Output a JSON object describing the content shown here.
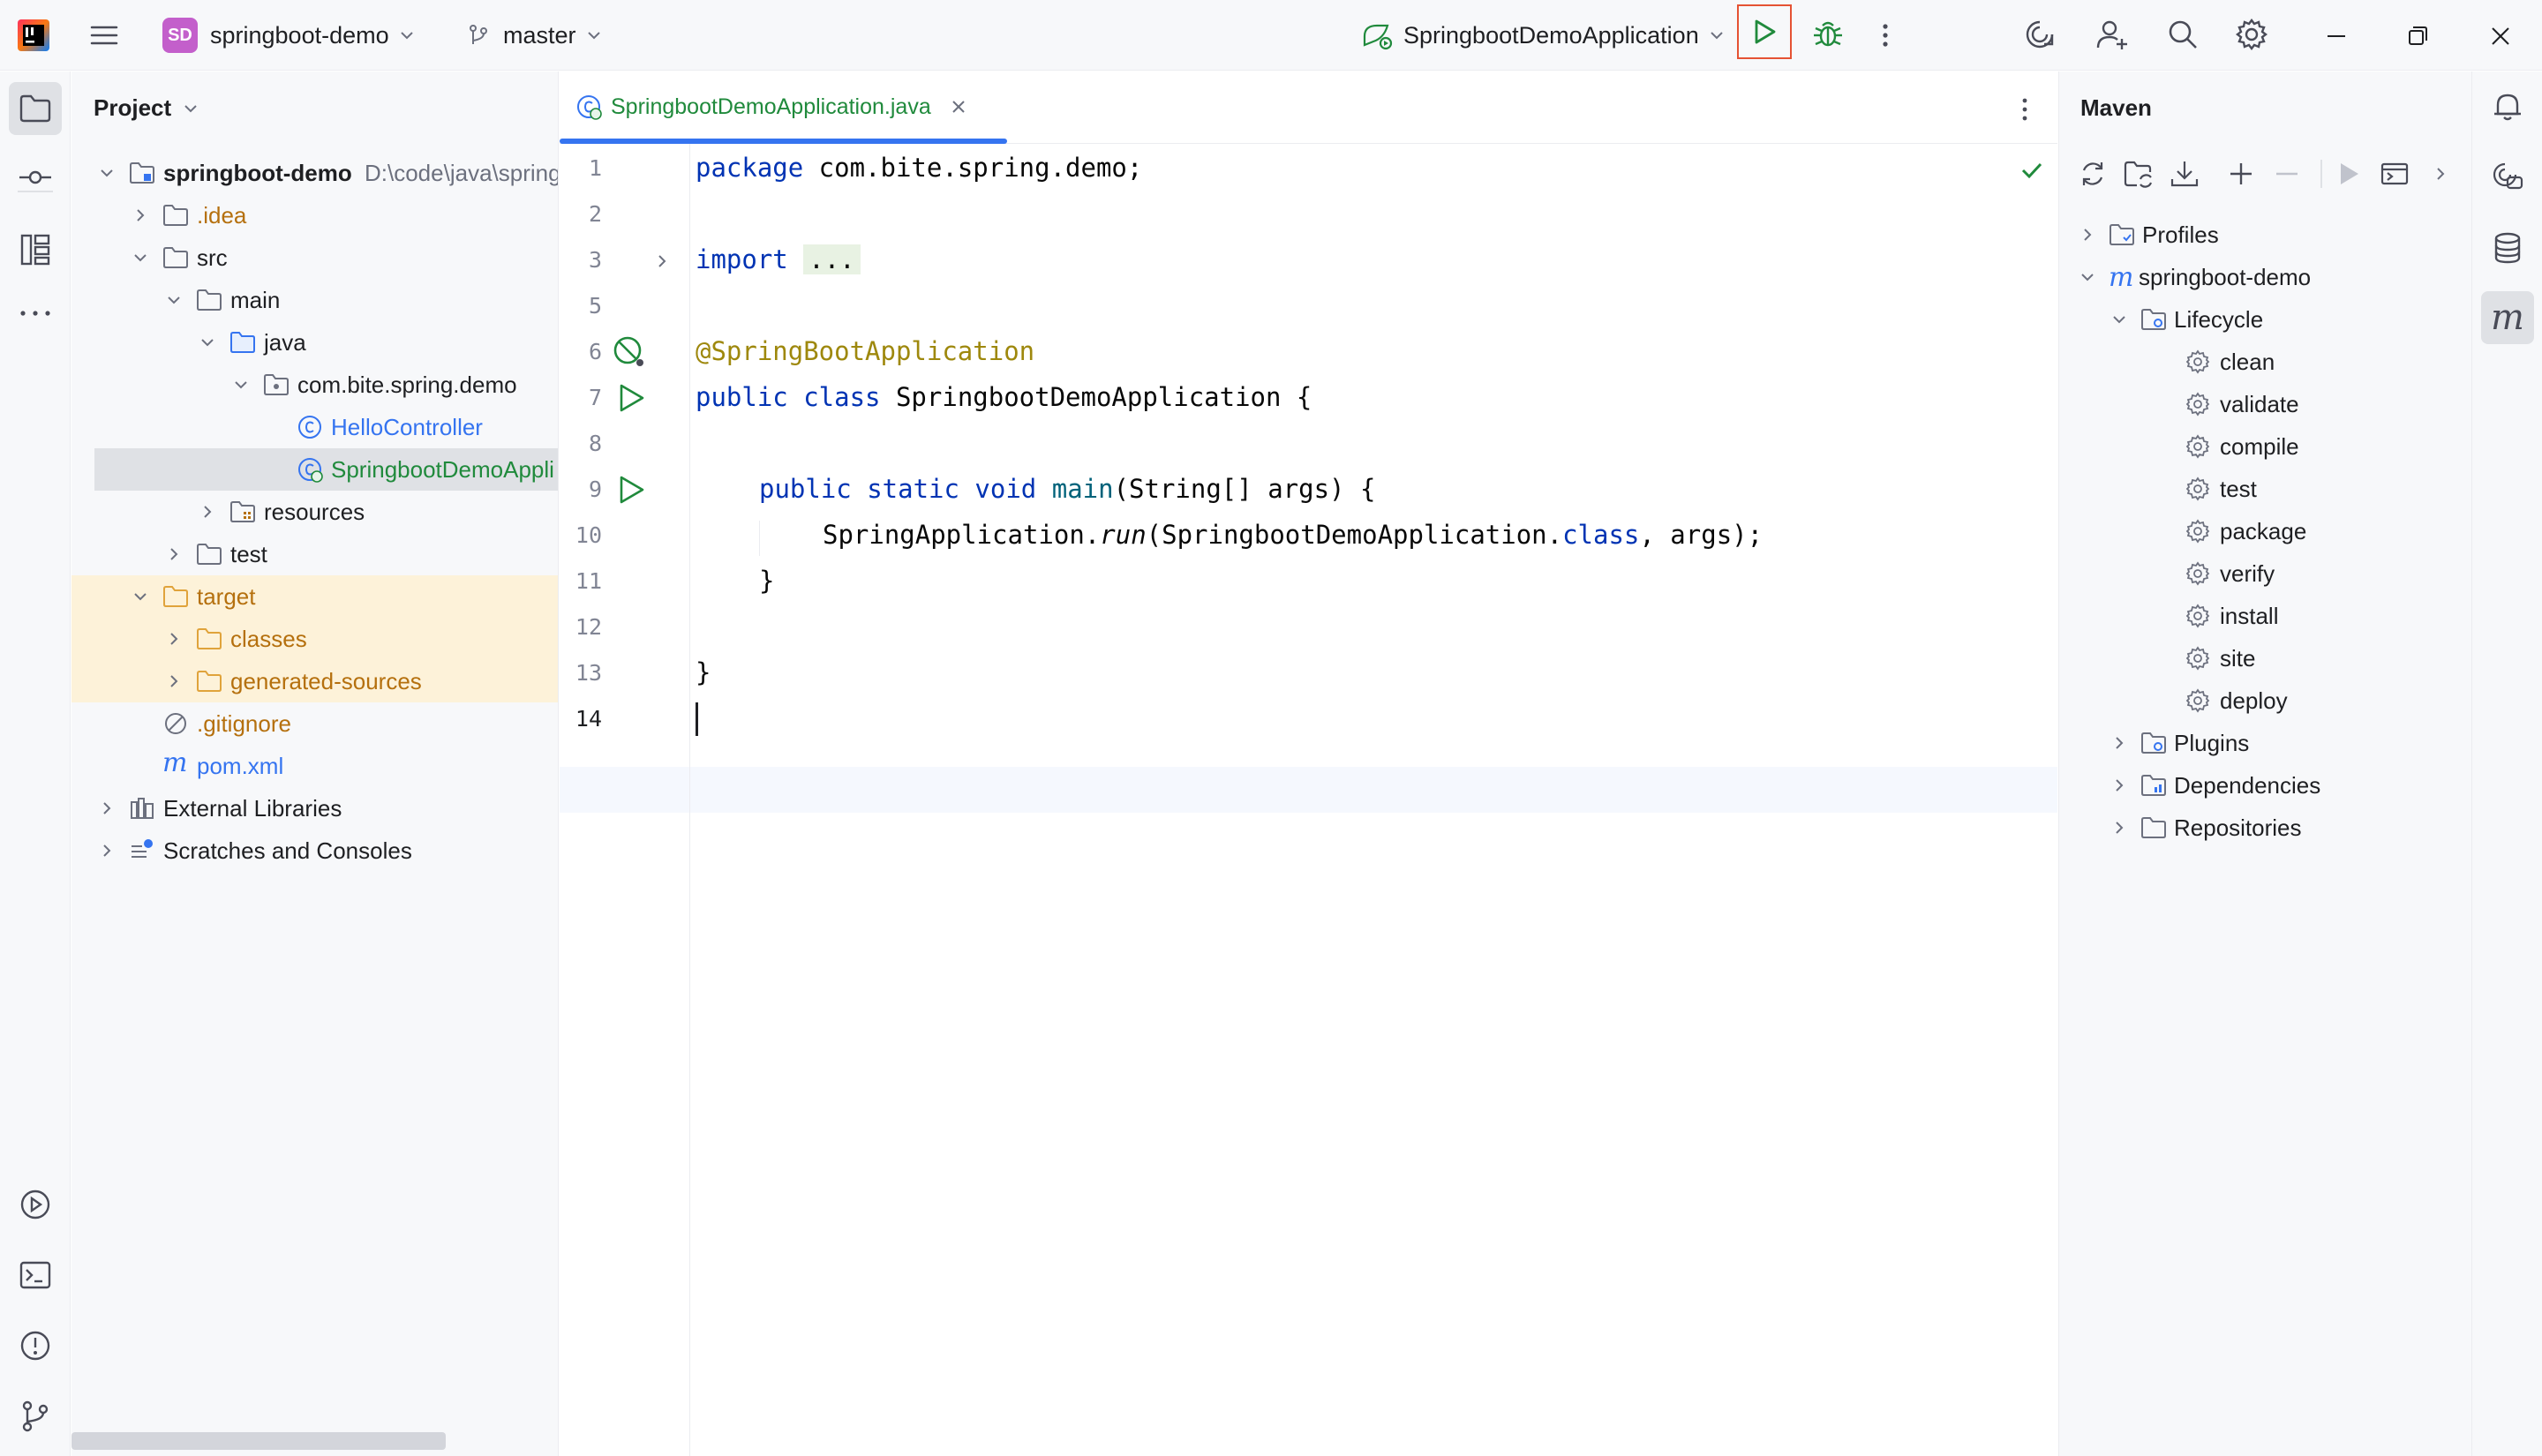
{
  "titlebar": {
    "project_badge": "SD",
    "project_name": "springboot-demo",
    "branch": "master",
    "run_config": "SpringbootDemoApplication"
  },
  "project_panel": {
    "title": "Project",
    "root_name": "springboot-demo",
    "root_path": "D:\\code\\java\\spring",
    "items": [
      {
        "label": ".idea"
      },
      {
        "label": "src"
      },
      {
        "label": "main"
      },
      {
        "label": "java"
      },
      {
        "label": "com.bite.spring.demo"
      },
      {
        "label": "HelloController"
      },
      {
        "label": "SpringbootDemoAppli"
      },
      {
        "label": "resources"
      },
      {
        "label": "test"
      },
      {
        "label": "target"
      },
      {
        "label": "classes"
      },
      {
        "label": "generated-sources"
      },
      {
        "label": ".gitignore"
      },
      {
        "label": "pom.xml"
      },
      {
        "label": "External Libraries"
      },
      {
        "label": "Scratches and Consoles"
      }
    ]
  },
  "editor": {
    "tab_label": "SpringbootDemoApplication.java",
    "line_numbers": [
      "1",
      "2",
      "3",
      "5",
      "6",
      "7",
      "8",
      "9",
      "10",
      "11",
      "12",
      "13",
      "14"
    ],
    "code": {
      "l1_kw": "package",
      "l1_rest": " com.bite.spring.demo;",
      "l3_kw": "import",
      "l3_fold": "...",
      "l6": "@SpringBootApplication",
      "l7_kw": "public class",
      "l7_rest": " SpringbootDemoApplication {",
      "l9_kw": "public static void",
      "l9_fn": "main",
      "l9_rest": "(String[] args) {",
      "l10_a": "SpringApplication.",
      "l10_run": "run",
      "l10_b": "(SpringbootDemoApplication.",
      "l10_class": "class",
      "l10_c": ", args);",
      "l11": "}",
      "l13": "}"
    }
  },
  "maven": {
    "title": "Maven",
    "profiles": "Profiles",
    "project": "springboot-demo",
    "lifecycle": "Lifecycle",
    "goals": [
      "clean",
      "validate",
      "compile",
      "test",
      "package",
      "verify",
      "install",
      "site",
      "deploy"
    ],
    "plugins": "Plugins",
    "dependencies": "Dependencies",
    "repositories": "Repositories"
  },
  "colors": {
    "accent": "#3574f0",
    "run_green": "#208a3c",
    "highlight_border": "#e55233",
    "target_bg": "#fdf2d9",
    "selection_bg": "#dfe1e5"
  }
}
